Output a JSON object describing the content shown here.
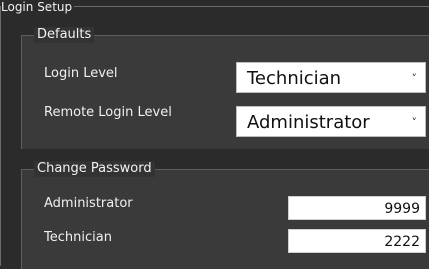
{
  "window": {
    "section_title": "Login Setup"
  },
  "defaults": {
    "title": "Defaults",
    "login_level": {
      "label": "Login Level",
      "value": "Technician"
    },
    "remote_login_level": {
      "label": "Remote Login Level",
      "value": "Administrator"
    }
  },
  "change_password": {
    "title": "Change Password",
    "administrator": {
      "label": "Administrator",
      "value": "9999"
    },
    "technician": {
      "label": "Technician",
      "value": "2222"
    }
  },
  "icons": {
    "dropdown": "chevron-down-icon"
  }
}
